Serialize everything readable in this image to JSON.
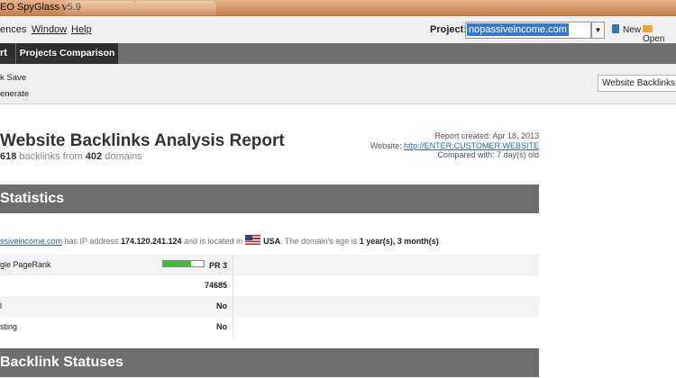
{
  "window": {
    "title": "EO SpyGlass v5.9"
  },
  "menu": {
    "items": [
      "ences",
      "Window",
      "Help"
    ]
  },
  "project": {
    "label": "Project:",
    "value": "nopassiveincome.com"
  },
  "toolbar": {
    "new_label": "New",
    "open_label": "Open"
  },
  "tabs": [
    "rt",
    "Projects Comparison"
  ],
  "actions": {
    "quick_save": "k Save",
    "regenerate": "enerate"
  },
  "template_select": "Website Backlinks A",
  "report": {
    "title": "Website Backlinks Analysis Report",
    "backlinks_count": "618",
    "backlinks_text": "backlinks from",
    "domains_count": "402",
    "domains_text": "domains",
    "created": "Report created: Apr 18, 2013",
    "website_label": "Website:",
    "website_link": "http://ENTER.CUSTOMER.WEBSITE",
    "compared": "Compared with: 7 day(s) old"
  },
  "sections": {
    "statistics": "Statistics",
    "backlink_statuses": "Backlink Statuses"
  },
  "ipinfo": {
    "domain": "ssiveincome.com",
    "t1": "has IP address",
    "ip": "174.120.241.124",
    "t2": "and is located in",
    "country": "USA",
    "t3": ". The domain's age is",
    "age": "1 year(s), 3 month(s)",
    "t4": "."
  },
  "stats": [
    {
      "label": "gle PageRank",
      "value": "PR 3",
      "pagerank_fill": 0.7
    },
    {
      "label": "",
      "value": "74685"
    },
    {
      "label": "l",
      "value": "No"
    },
    {
      "label": "sting",
      "value": "No"
    }
  ],
  "colors": {
    "accent": "#3a79c9",
    "section_bar": "#6e6e6e",
    "pr_green": "#3fbf35"
  }
}
